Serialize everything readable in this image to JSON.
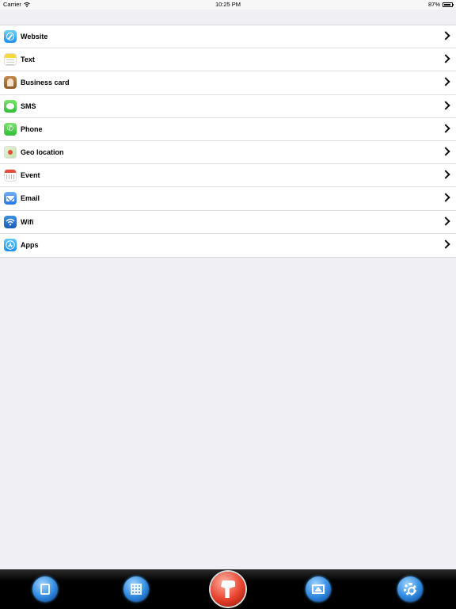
{
  "status_bar": {
    "carrier": "Carrier",
    "time": "10:25 PM",
    "battery_text": "87%",
    "battery_level": 0.87
  },
  "list": {
    "items": [
      {
        "label": "Website",
        "icon": "compass-icon"
      },
      {
        "label": "Text",
        "icon": "notes-icon"
      },
      {
        "label": "Business card",
        "icon": "contact-card-icon"
      },
      {
        "label": "SMS",
        "icon": "message-bubble-icon"
      },
      {
        "label": "Phone",
        "icon": "phone-icon"
      },
      {
        "label": "Geo location",
        "icon": "map-pin-icon"
      },
      {
        "label": "Event",
        "icon": "calendar-icon"
      },
      {
        "label": "Email",
        "icon": "envelope-icon"
      },
      {
        "label": "Wifi",
        "icon": "wifi-icon"
      },
      {
        "label": "Apps",
        "icon": "app-store-icon"
      }
    ]
  },
  "tab_bar": {
    "tabs": [
      {
        "icon": "clipboard-icon"
      },
      {
        "icon": "qr-code-icon"
      },
      {
        "icon": "scanner-icon",
        "active": true
      },
      {
        "icon": "image-icon"
      },
      {
        "icon": "settings-gear-icon"
      }
    ]
  },
  "colors": {
    "background": "#efeff4",
    "scan_button": "#e8412d",
    "tab_button": "#2f8ae0"
  }
}
